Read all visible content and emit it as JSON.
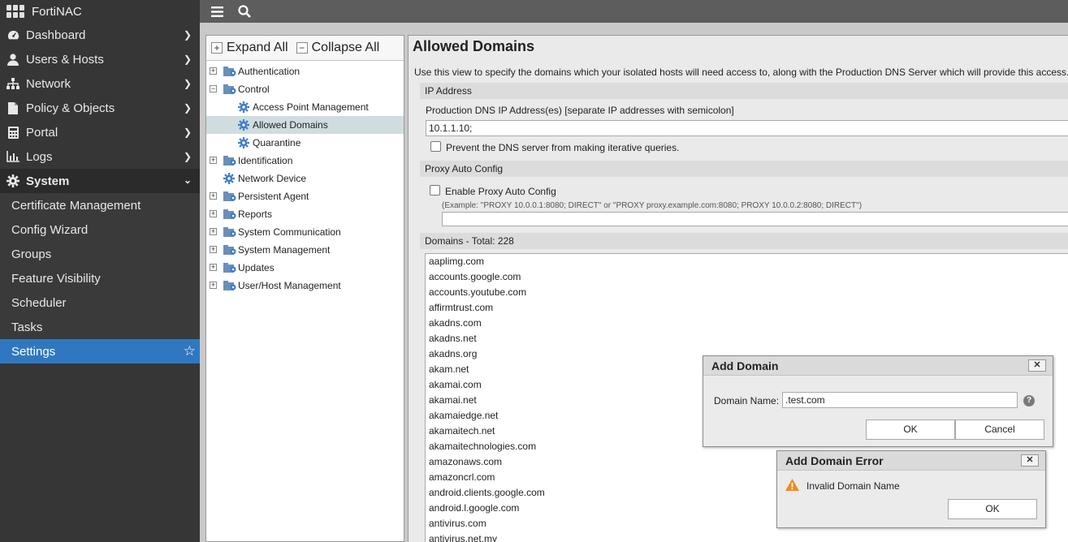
{
  "app": {
    "name": "FortiNAC"
  },
  "sidebar": {
    "nav": [
      {
        "label": "Dashboard",
        "icon": "dashboard-icon"
      },
      {
        "label": "Users & Hosts",
        "icon": "user-icon"
      },
      {
        "label": "Network",
        "icon": "network-icon"
      },
      {
        "label": "Policy & Objects",
        "icon": "document-icon"
      },
      {
        "label": "Portal",
        "icon": "portal-icon"
      },
      {
        "label": "Logs",
        "icon": "chart-icon"
      },
      {
        "label": "System",
        "icon": "gear-icon"
      }
    ],
    "system_items": [
      {
        "label": "Certificate Management"
      },
      {
        "label": "Config Wizard"
      },
      {
        "label": "Groups"
      },
      {
        "label": "Feature Visibility"
      },
      {
        "label": "Scheduler"
      },
      {
        "label": "Tasks"
      },
      {
        "label": "Settings"
      }
    ]
  },
  "tree": {
    "expand_all": "Expand All",
    "collapse_all": "Collapse All",
    "nodes": [
      {
        "label": "Authentication",
        "toggle": "+"
      },
      {
        "label": "Control",
        "toggle": "−"
      },
      {
        "label": "Access Point Management"
      },
      {
        "label": "Allowed Domains",
        "selected": true
      },
      {
        "label": "Quarantine"
      },
      {
        "label": "Identification",
        "toggle": "+"
      },
      {
        "label": "Network Device"
      },
      {
        "label": "Persistent Agent",
        "toggle": "+"
      },
      {
        "label": "Reports",
        "toggle": "+"
      },
      {
        "label": "System Communication",
        "toggle": "+"
      },
      {
        "label": "System Management",
        "toggle": "+"
      },
      {
        "label": "Updates",
        "toggle": "+"
      },
      {
        "label": "User/Host Management",
        "toggle": "+"
      }
    ]
  },
  "main": {
    "title": "Allowed Domains",
    "description": "Use this view to specify the domains which your isolated hosts will need access to, along with the Production DNS Server which will provide this access.",
    "ip_section": "IP Address",
    "dns_label": "Production DNS IP Address(es) [separate IP addresses with semicolon]",
    "dns_value": "10.1.1.10;",
    "prevent_label": "Prevent the DNS server from making iterative queries.",
    "proxy_section": "Proxy Auto Config",
    "proxy_enable_label": "Enable Proxy Auto Config",
    "proxy_example": "(Example: \"PROXY 10.0.0.1:8080; DIRECT\" or \"PROXY proxy.example.com:8080; PROXY 10.0.0.2:8080; DIRECT\")",
    "proxy_value": "",
    "domains_section": "Domains - Total: 228",
    "domains": [
      "aaplimg.com",
      "accounts.google.com",
      "accounts.youtube.com",
      "affirmtrust.com",
      "akadns.com",
      "akadns.net",
      "akadns.org",
      "akam.net",
      "akamai.com",
      "akamai.net",
      "akamaiedge.net",
      "akamaitech.net",
      "akamaitechnologies.com",
      "amazonaws.com",
      "amazoncrl.com",
      "android.clients.google.com",
      "android.l.google.com",
      "antivirus.com",
      "antivirus.net.my"
    ]
  },
  "add_domain_dialog": {
    "title": "Add Domain",
    "close": "✕",
    "field_label": "Domain Name:",
    "field_value": ".test.com",
    "ok": "OK",
    "cancel": "Cancel"
  },
  "error_dialog": {
    "title": "Add Domain Error",
    "close": "✕",
    "message": "Invalid Domain Name",
    "ok": "OK"
  }
}
